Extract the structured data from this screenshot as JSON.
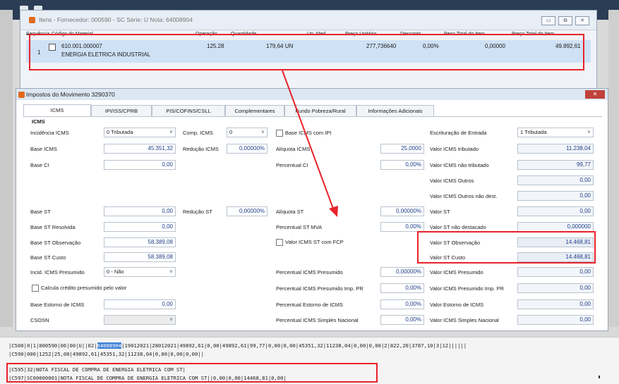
{
  "items_window": {
    "title": "Itens - Fornecedor: 000590 - SC Série: U   Nota: 64008904",
    "buttons": [
      "▭",
      "⧉",
      "✕"
    ],
    "columns": [
      "Sequência",
      "Código do Material",
      "Operação",
      "Quantidade",
      "Un. Med",
      "Preço Unitário",
      "Desconto",
      "Peso Total do Item",
      "Preço Total do Item"
    ],
    "row": {
      "seq": "1",
      "code": "610.001.000007",
      "description": "ENERGIA ELETRICA INDUSTRIAL",
      "operation": "125.28",
      "quantity": "179,64 UN",
      "unit_price": "277,736640",
      "discount": "0,00%",
      "weight": "0,00000",
      "total": "49.892,61"
    }
  },
  "taxes_window": {
    "title": "Impostos do Movimento 3290370",
    "close_label": "✕",
    "tabs": [
      "ICMS",
      "IPI/ISS/CPRB",
      "PIS/COFINS/CSLL",
      "Complementares",
      "Fundo Pobreza/Rural",
      "Informações Adicionais"
    ],
    "section": "ICMS",
    "col1": {
      "incidencia_label": "Incidência ICMS",
      "incidencia_value": "0 Tributada",
      "base_icms_label": "Base ICMS",
      "base_icms": "45.351,32",
      "base_ci_label": "Base CI",
      "base_ci": "0,00",
      "base_st_label": "Base ST",
      "base_st": "0,00",
      "base_st_resolvida_label": "Base ST Resolvida",
      "base_st_resolvida": "0,00",
      "base_st_obs_label": "Base ST Observação",
      "base_st_obs": "58.389,08",
      "base_st_custo_label": "Base ST Custo",
      "base_st_custo": "58.389,08",
      "incid_presumido_label": "Incid. ICMS Presumido",
      "incid_presumido_value": "0 - Não",
      "calc_presumido_label": "Calcula crédito presumido pelo valor",
      "base_estorno_label": "Base Estorno de ICMS",
      "base_estorno": "0,00",
      "csosn_label": "CSOSN"
    },
    "col2": {
      "comp_icms_label": "Comp. ICMS",
      "comp_icms_value": "0",
      "reducao_icms_label": "Redução ICMS",
      "reducao_icms": "0,00000%",
      "reducao_st_label": "Redução ST",
      "reducao_st": "0,00000%"
    },
    "col3": {
      "base_icms_ipi_label": "Base ICMS com IPI",
      "aliquota_icms_label": "Alíquota ICMS",
      "aliquota_icms": "25,0000",
      "percentual_ci_label": "Percentual CI",
      "percentual_ci": "0,00%",
      "aliquota_st_label": "Alíquota ST",
      "aliquota_st": "0,00000%",
      "percentual_st_mva_label": "Percentual ST MVA",
      "percentual_st_mva": "0,00%",
      "valor_st_fcp_label": "Valor ICMS ST com FCP",
      "perc_presumido_label": "Percentual ICMS Presumido",
      "perc_presumido": "0,00000%",
      "perc_presumido_pr_label": "Percentual ICMS Presumido Imp. PR",
      "perc_presumido_pr": "0,00%",
      "perc_estorno_label": "Percentual Estorno de ICMS",
      "perc_estorno": "0,00%",
      "perc_simples_label": "Percentual ICMS Simples Nacional",
      "perc_simples": "0,00%"
    },
    "col4": {
      "escrituracao_label": "Escrituração de Entrada",
      "escrituracao_value": "1 Tributada",
      "valor_tributado_label": "Valor ICMS tributado",
      "valor_tributado": "11.238,04",
      "valor_nao_tributado_label": "Valor ICMS não tributado",
      "valor_nao_tributado": "99,77",
      "valor_outros_label": "Valor ICMS Outros",
      "valor_outros": "0,00",
      "valor_outros_nd_label": "Valor ICMS Outros não dest.",
      "valor_outros_nd": "0,00",
      "valor_st_label": "Valor ST",
      "valor_st": "0,00",
      "valor_st_nd_label": "Valor ST não destacado",
      "valor_st_nd": "0,000000",
      "valor_st_obs_label": "Valor ST Observação",
      "valor_st_obs": "14.468,81",
      "valor_st_custo_label": "Valor ST Custo",
      "valor_st_custo": "14.468,81",
      "valor_presumido_label": "Valor ICMS Presumido",
      "valor_presumido": "0,00",
      "valor_presumido_pr_label": "Valor ICMS Presumido Imp. PR",
      "valor_presumido_pr": "0,00",
      "valor_estorno_label": "Valor Estorno de ICMS",
      "valor_estorno": "0,00",
      "valor_simples_label": "Valor ICMS Simples Nacional",
      "valor_simples": "0,00"
    }
  },
  "sped": {
    "line1_prefix": "|C500|0|1|000590|06|00|U||02|",
    "line1_highlight": "64008904",
    "line1_suffix": "|19012021|28012021|49892,61|0,00|49892,61|99,77|0,00|0,00|45351,32|11238,04|0,00|0,00|2|822,20|3787,10|3|12||||||",
    "line2": "|C590|000|1252|25,00|49892,61|45351,32|11238,04|0,00|0,00|0,00||",
    "line3": "|C595|32|NOTA FISCAL DE COMPRA DE ENERGIA ELETRICA COM ST|",
    "line4": "|C597|SC00000001|NOTA FISCAL DE COMPRA DE ENERGIA ELETRICA COM ST||0,00|0,00|14468,81|0,00|"
  },
  "colors": {
    "highlight_red": "#e8222a",
    "value_blue": "#1f3f8a",
    "selection_blue": "#cfe1f5"
  }
}
